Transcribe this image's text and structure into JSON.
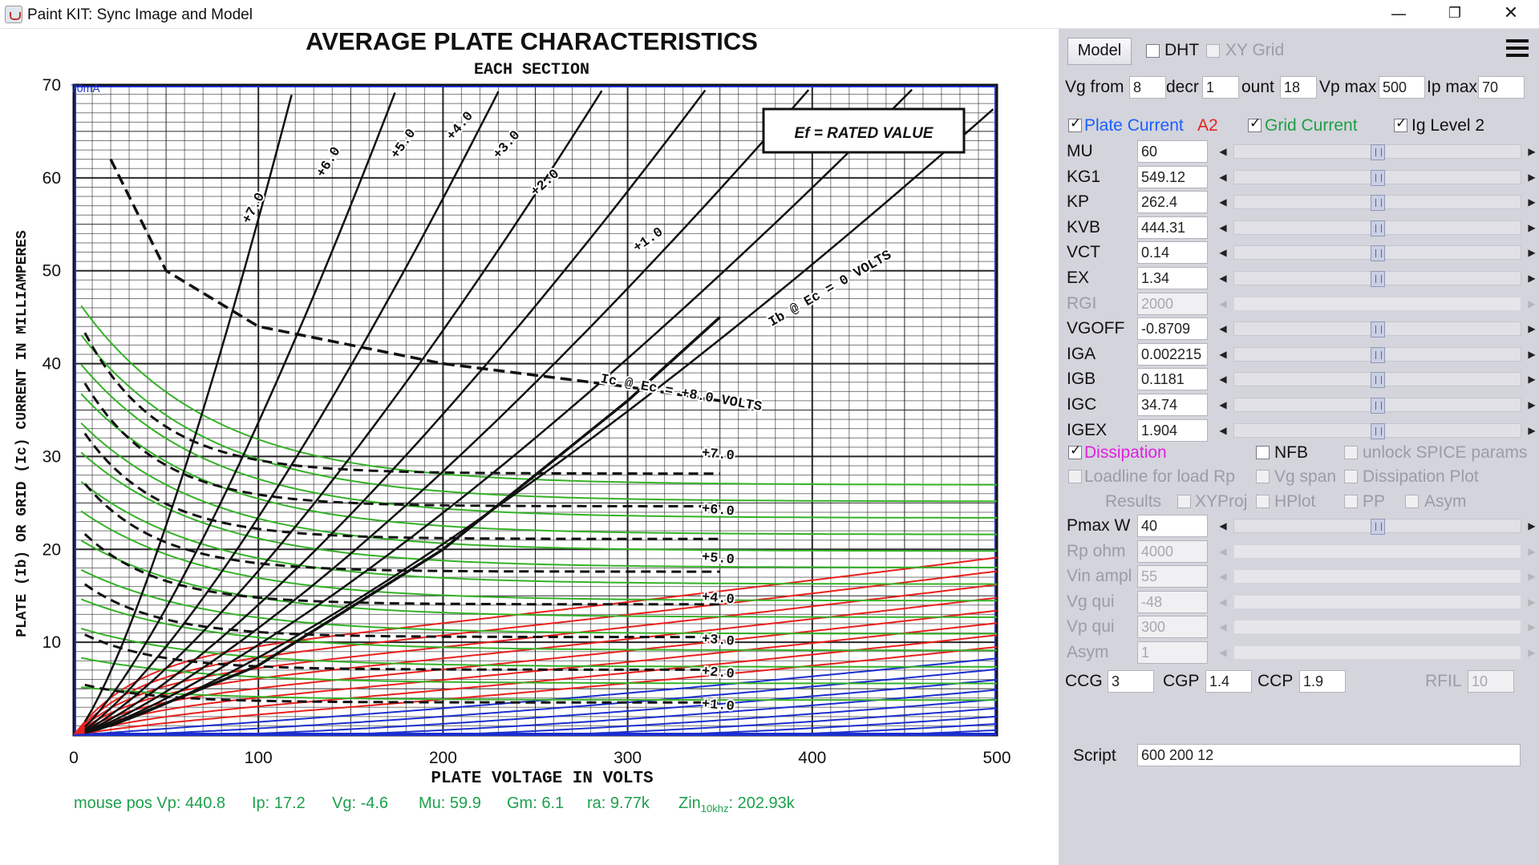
{
  "window": {
    "title": "Paint KIT: Sync Image and Model",
    "icons": [
      "java-app-icon",
      "minimize-icon",
      "restore-icon",
      "close-icon"
    ]
  },
  "chart_data": {
    "type": "line",
    "title": "AVERAGE PLATE CHARACTERISTICS",
    "subtitle": "EACH SECTION",
    "xlabel": "PLATE VOLTAGE IN VOLTS",
    "ylabel": "PLATE (Ib) OR GRID (Ic) CURRENT IN MILLIAMPERES",
    "xlim": [
      0,
      500
    ],
    "ylim": [
      0,
      70
    ],
    "x_ticks": [
      "0",
      "100",
      "200",
      "300",
      "400",
      "500"
    ],
    "y_ticks": [
      "10",
      "20",
      "30",
      "40",
      "50",
      "60",
      "70"
    ],
    "grid": true,
    "annotation": "Ef = RATED VALUE",
    "corner_label": "70mA",
    "scanned_curve_labels": [
      "+7.0",
      "+6.0",
      "+5.0",
      "+4.0",
      "+3.0",
      "+2.0",
      "+1.0",
      "Ib @ Ec = 0 VOLTS",
      "Ic @ Ec = +8.0 VOLTS",
      "+7.0",
      "+6.0",
      "+5.0",
      "+4.0",
      "+3.0",
      "+2.0",
      "+1.0"
    ],
    "series": [
      {
        "name": "Ib @ Ec = 0 VOLTS",
        "x": [
          20,
          100,
          200,
          300,
          350
        ],
        "y": [
          1,
          7.5,
          20,
          36,
          45
        ]
      },
      {
        "name": "Ic @ Ec = +8.0 VOLTS",
        "x": [
          20,
          50,
          100,
          200,
          300,
          350
        ],
        "y": [
          62,
          50,
          44,
          40,
          37.5,
          36
        ]
      }
    ]
  },
  "status": {
    "mouse_pos": "mouse pos Vp: 440.8",
    "ip": "Ip: 17.2",
    "vg": "Vg: -4.6",
    "mu": "Mu: 59.9",
    "gm": "Gm: 6.1",
    "ra": "ra: 9.77k",
    "zin_label": "Zin",
    "zin_sub": "10khz",
    "zin_value": ": 202.93k"
  },
  "panel": {
    "model_button": "Model",
    "dht": {
      "label": "DHT",
      "checked": false
    },
    "xy_grid": {
      "label": "XY Grid",
      "checked": false,
      "enabled": false
    },
    "vg_from": {
      "label": "Vg from",
      "value": "8"
    },
    "decr": {
      "label": "decr",
      "value": "1"
    },
    "count": {
      "label": "ount",
      "value": "18"
    },
    "vp_max": {
      "label": "Vp max",
      "value": "500"
    },
    "ip_max": {
      "label": "Ip max",
      "value": "70"
    },
    "plate_current": {
      "label": "Plate Current",
      "checked": true,
      "color": "#1a5fff"
    },
    "a2": {
      "label": "A2",
      "color": "#e8211d"
    },
    "grid_current": {
      "label": "Grid Current",
      "checked": true,
      "color": "#1e9e45"
    },
    "ig_level2": {
      "label": "Ig Level 2",
      "checked": true
    },
    "params": [
      {
        "name": "MU",
        "value": "60",
        "enabled": true,
        "level": 0.5
      },
      {
        "name": "KG1",
        "value": "549.12",
        "enabled": true,
        "level": 0.5
      },
      {
        "name": "KP",
        "value": "262.4",
        "enabled": true,
        "level": 0.5
      },
      {
        "name": "KVB",
        "value": "444.31",
        "enabled": true,
        "level": 0.5
      },
      {
        "name": "VCT",
        "value": "0.14",
        "enabled": true,
        "level": 0.5
      },
      {
        "name": "EX",
        "value": "1.34",
        "enabled": true,
        "level": 0.5
      },
      {
        "name": "RGI",
        "value": "2000",
        "enabled": false,
        "level": null
      },
      {
        "name": "VGOFF",
        "value": "-0.8709",
        "enabled": true,
        "level": 0.5
      },
      {
        "name": "IGA",
        "value": "0.002215",
        "enabled": true,
        "level": 0.5
      },
      {
        "name": "IGB",
        "value": "0.1181",
        "enabled": true,
        "level": 0.5
      },
      {
        "name": "IGC",
        "value": "34.74",
        "enabled": true,
        "level": 0.5
      },
      {
        "name": "IGEX",
        "value": "1.904",
        "enabled": true,
        "level": 0.5
      }
    ],
    "dissipation": {
      "label": "Dissipation",
      "checked": true,
      "color": "#e020e0"
    },
    "nfb": {
      "label": "NFB",
      "checked": false
    },
    "unlock_spice": {
      "label": "unlock SPICE params",
      "checked": false,
      "enabled": false
    },
    "loadline": {
      "label": "Loadline for load Rp",
      "checked": false,
      "enabled": false
    },
    "vg_span": {
      "label": "Vg span",
      "checked": false,
      "enabled": false
    },
    "dissipation_plot": {
      "label": "Dissipation Plot",
      "checked": false,
      "enabled": false
    },
    "results": {
      "label": "Results"
    },
    "xyproj": {
      "label": "XYProj",
      "checked": false,
      "enabled": false
    },
    "hplot": {
      "label": "HPlot",
      "checked": false,
      "enabled": false
    },
    "pp": {
      "label": "PP",
      "checked": false,
      "enabled": false
    },
    "asym_cb": {
      "label": "Asym",
      "checked": false,
      "enabled": false
    },
    "loadline_params": [
      {
        "name": "Pmax W",
        "value": "40",
        "enabled": true,
        "level": 0.5
      },
      {
        "name": "Rp ohm",
        "value": "4000",
        "enabled": false,
        "level": null
      },
      {
        "name": "Vin ampl",
        "value": "55",
        "enabled": false,
        "level": null
      },
      {
        "name": "Vg qui",
        "value": "-48",
        "enabled": false,
        "level": null
      },
      {
        "name": "Vp qui",
        "value": "300",
        "enabled": false,
        "level": null
      },
      {
        "name": "Asym",
        "value": "1",
        "enabled": false,
        "level": null
      }
    ],
    "ccg": {
      "label": "CCG",
      "value": "3"
    },
    "cgp": {
      "label": "CGP",
      "value": "1.4"
    },
    "ccp": {
      "label": "CCP",
      "value": "1.9"
    },
    "rfil": {
      "label": "RFIL",
      "value": "10",
      "enabled": false
    },
    "script": {
      "label": "Script",
      "value": "600 200 12"
    }
  }
}
